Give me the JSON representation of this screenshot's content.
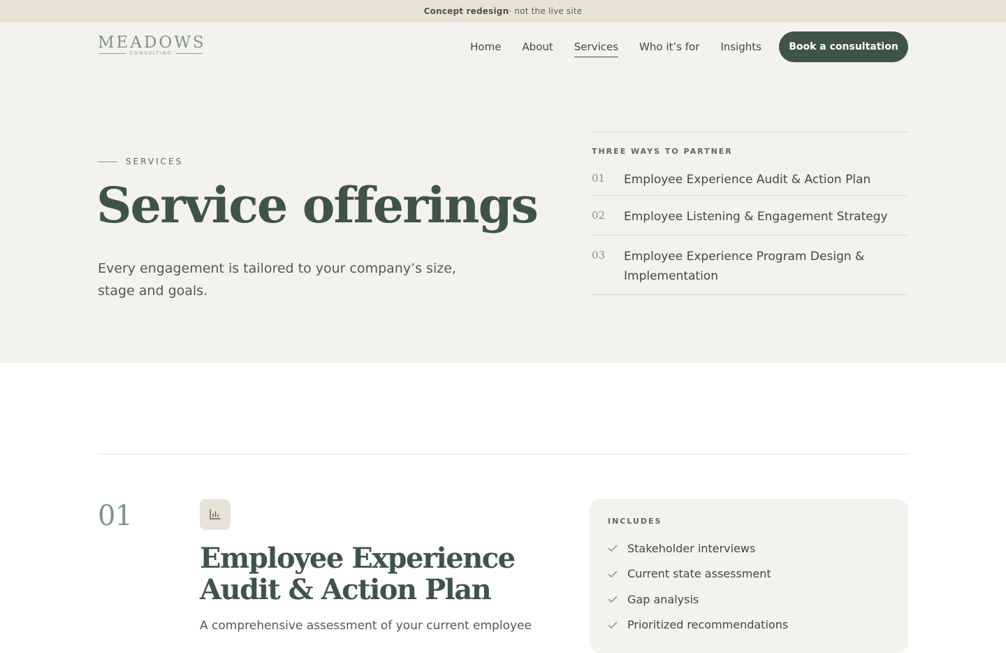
{
  "notice": {
    "strong": "Concept redesign",
    "rest": " · not the live site"
  },
  "logo": {
    "word": "MEADOWS",
    "sub": "CONSULTING"
  },
  "nav": {
    "items": [
      "Home",
      "About",
      "Services",
      "Who it’s for",
      "Insights"
    ],
    "active": "Services",
    "cta": "Book a consultation"
  },
  "hero": {
    "eyebrow": "SERVICES",
    "title": "Service offerings",
    "subtitle": "Every engagement is tailored to your company’s size, stage and goals."
  },
  "partner": {
    "label": "THREE WAYS TO PARTNER",
    "items": [
      {
        "num": "01",
        "text": "Employee Experience Audit & Action Plan"
      },
      {
        "num": "02",
        "text": "Employee Listening & Engagement Strategy"
      },
      {
        "num": "03",
        "text": "Employee Experience Program Design & Implementation"
      }
    ]
  },
  "service": {
    "num": "01",
    "icon": "bar-chart-icon",
    "title": "Employee Experience Audit & Action Plan",
    "description": "A comprehensive assessment of your current employee",
    "includes_label": "INCLUDES",
    "includes": [
      "Stakeholder interviews",
      "Current state assessment",
      "Gap analysis",
      "Prioritized recommendations"
    ]
  },
  "colors": {
    "accent": "#3f5449",
    "sage": "#7f9585",
    "background": "#f4f2ee",
    "notice_bg": "#e8e3d9"
  }
}
